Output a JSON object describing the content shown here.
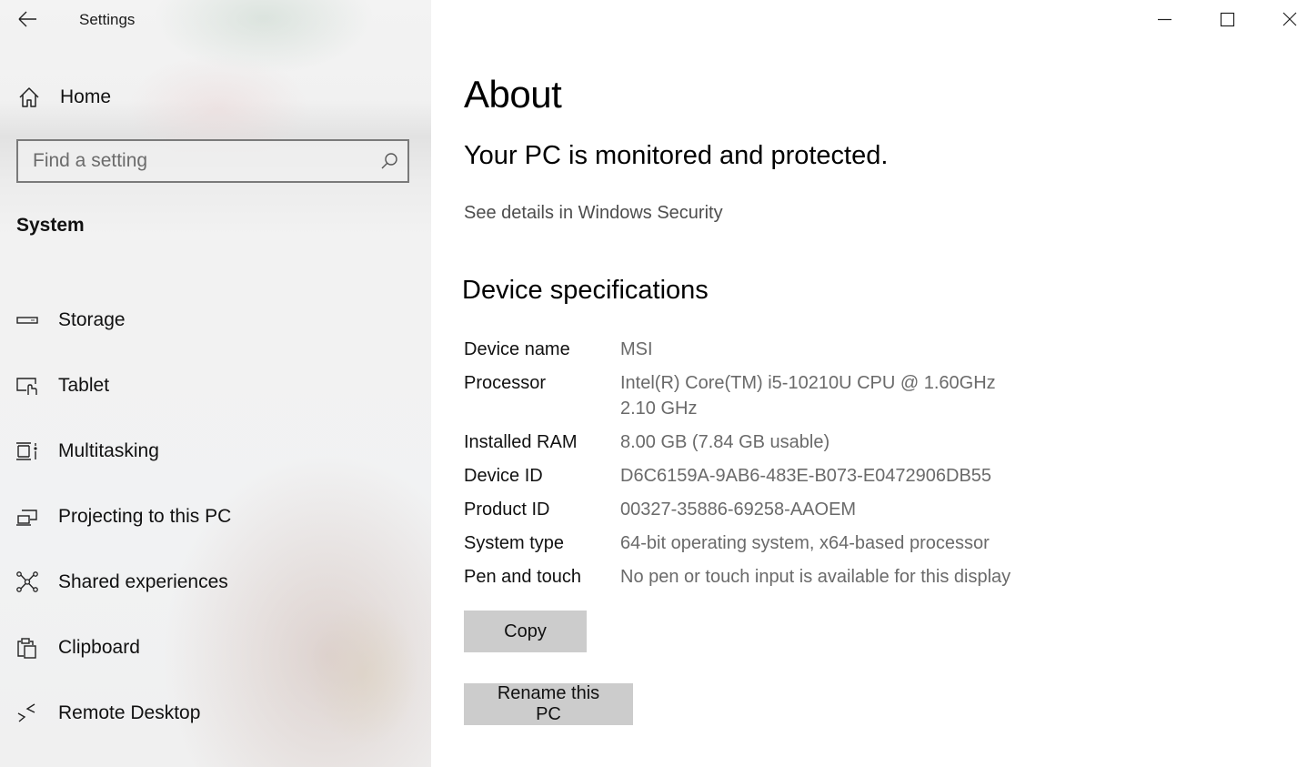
{
  "window": {
    "app_title": "Settings",
    "controls": {
      "minimize": "minimize-icon",
      "maximize": "maximize-icon",
      "close": "close-icon"
    }
  },
  "sidebar": {
    "back_icon": "back-arrow-icon",
    "home": {
      "label": "Home",
      "icon": "home-icon"
    },
    "search": {
      "placeholder": "Find a setting",
      "value": "",
      "icon": "search-icon"
    },
    "section_label": "System",
    "items": [
      {
        "label": "Storage",
        "icon": "storage-icon"
      },
      {
        "label": "Tablet",
        "icon": "tablet-icon"
      },
      {
        "label": "Multitasking",
        "icon": "multitasking-icon"
      },
      {
        "label": "Projecting to this PC",
        "icon": "projecting-icon"
      },
      {
        "label": "Shared experiences",
        "icon": "shared-experiences-icon"
      },
      {
        "label": "Clipboard",
        "icon": "clipboard-icon"
      },
      {
        "label": "Remote Desktop",
        "icon": "remote-desktop-icon"
      }
    ]
  },
  "main": {
    "title": "About",
    "status_heading": "Your PC is monitored and protected.",
    "security_link": "See details in Windows Security",
    "specs_heading": "Device specifications",
    "specs": [
      {
        "key": "Device name",
        "value": "MSI"
      },
      {
        "key": "Processor",
        "value": "Intel(R) Core(TM) i5-10210U CPU @ 1.60GHz   2.10 GHz"
      },
      {
        "key": "Installed RAM",
        "value": "8.00 GB (7.84 GB usable)"
      },
      {
        "key": "Device ID",
        "value": "D6C6159A-9AB6-483E-B073-E0472906DB55"
      },
      {
        "key": "Product ID",
        "value": "00327-35886-69258-AAOEM"
      },
      {
        "key": "System type",
        "value": "64-bit operating system, x64-based processor"
      },
      {
        "key": "Pen and touch",
        "value": "No pen or touch input is available for this display"
      }
    ],
    "copy_button": "Copy",
    "rename_button": "Rename this PC"
  }
}
